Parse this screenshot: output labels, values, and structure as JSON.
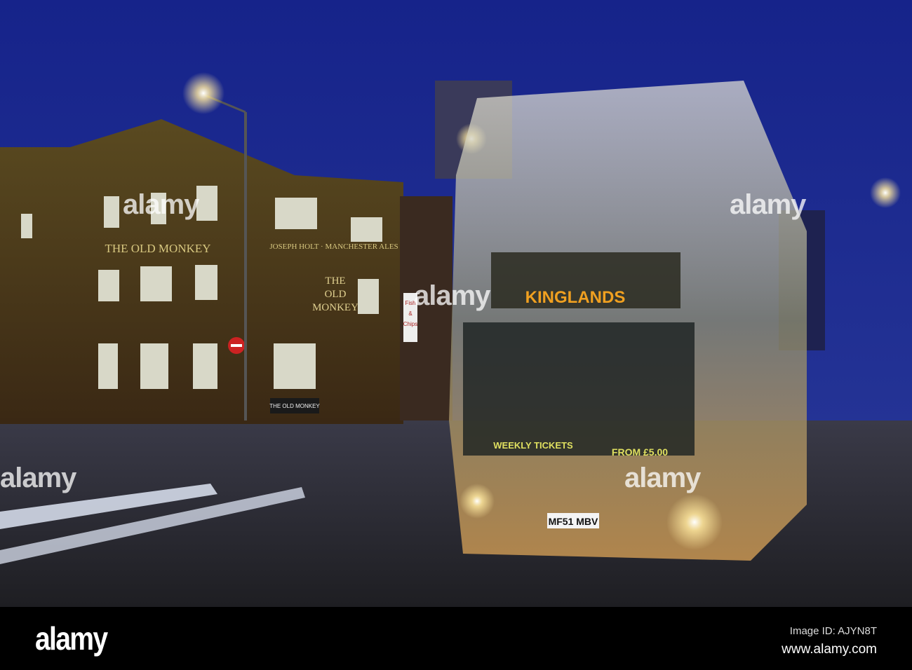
{
  "photo": {
    "pub_sign": "THE OLD MONKEY",
    "brewery_sign": "JOSEPH HOLT · MANCHESTER ALES",
    "hanging_sign": [
      "THE",
      "OLD",
      "MONKEY"
    ],
    "door_sign": "THE OLD MONKEY",
    "shop_sign": [
      "Fish",
      "&",
      "Chips"
    ],
    "bus_destination": "KINGLANDS",
    "bus_ad_left": "WEEKLY TICKETS",
    "bus_ad_right": "FROM £5.00",
    "number_plate": "MF51 MBV",
    "colors": {
      "sky": "#1a2a8a",
      "brick": "#4a3420",
      "road": "#2a2a30",
      "bus": "#d8d4c0"
    }
  },
  "watermark": {
    "text": "alamy"
  },
  "footer": {
    "logo": "alamy",
    "image_id": "Image ID: AJYN8T",
    "url": "www.alamy.com"
  }
}
